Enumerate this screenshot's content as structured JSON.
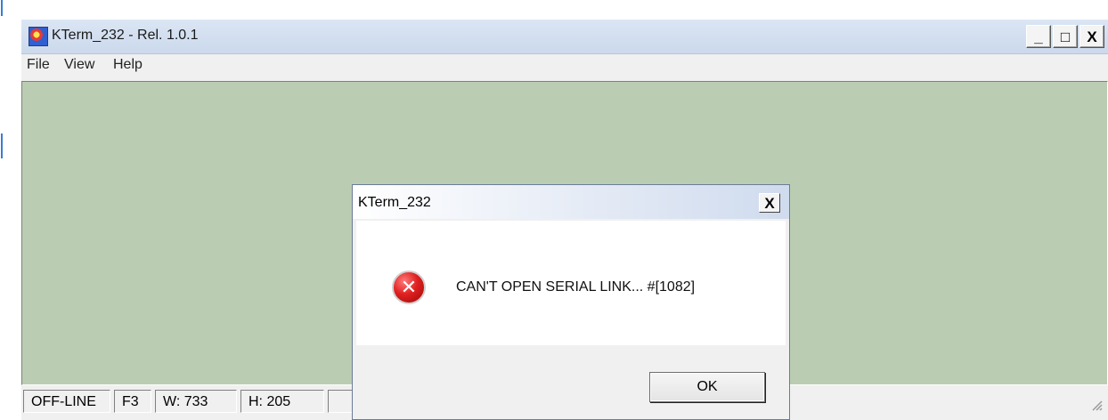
{
  "window": {
    "title": "KTerm_232 - Rel. 1.0.1",
    "buttons": {
      "minimize": "_",
      "maximize": "□",
      "close": "X"
    },
    "icon": "kterm-app-icon"
  },
  "menu": [
    {
      "label": "File"
    },
    {
      "label": "View"
    },
    {
      "label": "Help"
    }
  ],
  "client": {
    "background": "#bacdb3"
  },
  "status": [
    {
      "text": "OFF-LINE"
    },
    {
      "text": "F3"
    },
    {
      "text": "W:  733"
    },
    {
      "text": "H:  205"
    }
  ],
  "dialog": {
    "title": "KTerm_232",
    "close": "X",
    "icon": "error-icon",
    "icon_glyph": "✕",
    "message": "CAN'T OPEN SERIAL LINK...  #[1082]",
    "ok": "OK"
  },
  "colors": {
    "error": "#e02020",
    "titlebar": "#cbd9ec"
  }
}
